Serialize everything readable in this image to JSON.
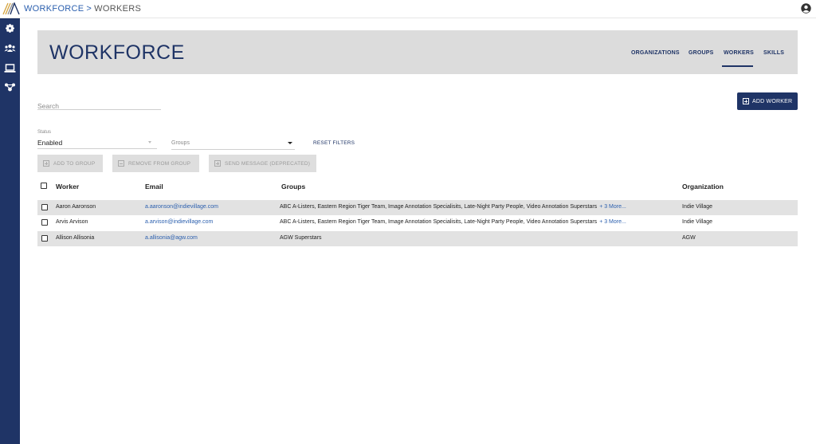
{
  "breadcrumb": {
    "root": "WORKFORCE",
    "separator": ">",
    "current": "WORKERS"
  },
  "header": {
    "title": "WORKFORCE",
    "nav": [
      {
        "label": "ORGANIZATIONS",
        "active": false
      },
      {
        "label": "GROUPS",
        "active": false
      },
      {
        "label": "WORKERS",
        "active": true
      },
      {
        "label": "SKILLS",
        "active": false
      }
    ]
  },
  "search": {
    "placeholder": "Search"
  },
  "add_worker": {
    "label": "ADD WORKER"
  },
  "filters": {
    "status_label": "Status",
    "status_value": "Enabled",
    "groups_placeholder": "Groups",
    "reset_label": "RESET FILTERS"
  },
  "actions": {
    "add_to_group": "ADD TO GROUP",
    "remove_from_group": "REMOVE FROM GROUP",
    "send_message": "SEND MESSAGE (DEPRECATED)"
  },
  "table": {
    "headers": {
      "worker": "Worker",
      "email": "Email",
      "groups": "Groups",
      "organization": "Organization"
    },
    "rows": [
      {
        "worker": "Aaron Aaronson",
        "email": "a.aaronson@indievillage.com",
        "groups": "ABC A-Listers, Eastern Region Tiger Team, Image Annotation Specialisits, Late-Night Party People, Video Annotation Superstars",
        "more": "+ 3 More...",
        "organization": "Indie Village"
      },
      {
        "worker": "Arvis Arvison",
        "email": "a.arvison@indievillage.com",
        "groups": "ABC A-Listers, Eastern Region Tiger Team, Image Annotation Specialisits, Late-Night Party People, Video Annotation Superstars",
        "more": "+ 3 More...",
        "organization": "Indie Village"
      },
      {
        "worker": "Allison Allisonia",
        "email": "a.allisonia@agw.com",
        "groups": "AGW Superstars",
        "more": "",
        "organization": "AGW"
      }
    ]
  },
  "colors": {
    "primary": "#1f3466",
    "link": "#2b5fae",
    "header_bg": "#dcdcdc",
    "row_shade": "#e2e2e2"
  },
  "icons": {
    "logo": "brand-logo",
    "user": "user-account-icon",
    "sidebar": [
      "gear-icon",
      "users-icon",
      "laptop-icon",
      "network-icon"
    ]
  }
}
